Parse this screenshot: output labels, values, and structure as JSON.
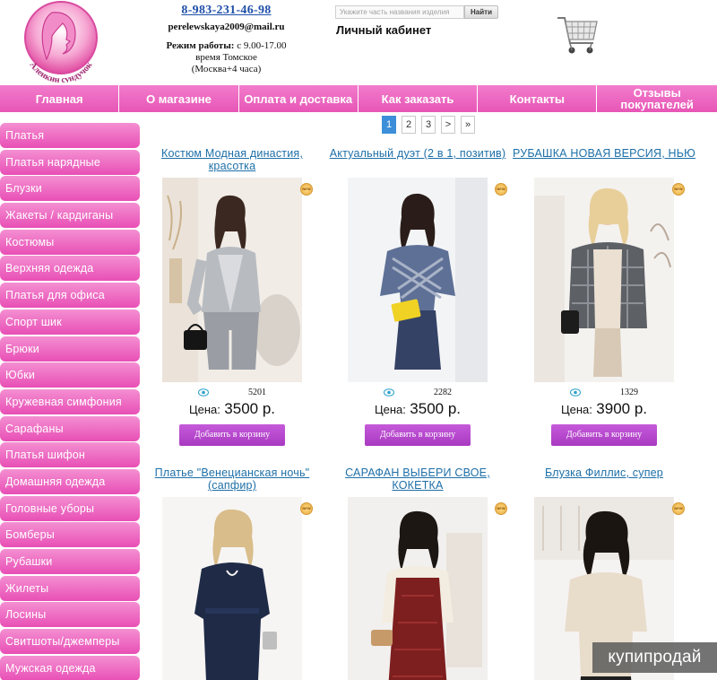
{
  "header": {
    "logo_text": "Аленкин сундучок",
    "phone": "8-983-231-46-98",
    "email": "perelewskaya2009@mail.ru",
    "hours_label": "Режим работы:",
    "hours_value": "с 9.00-17.00",
    "hours_zone": "время Томское",
    "hours_offset": "(Москва+4 часа)",
    "search_placeholder": "Укажите часть названия изделия",
    "search_button": "Найти",
    "account": "Личный кабинет"
  },
  "topnav": [
    "Главная",
    "О магазине",
    "Оплата и доставка",
    "Как заказать",
    "Контакты",
    "Отзывы покупателей"
  ],
  "sidebar": [
    "Платья",
    "Платья нарядные",
    "Блузки",
    "Жакеты / кардиганы",
    "Костюмы",
    "Верхняя одежда",
    "Платья для офиса",
    "Спорт шик",
    "Брюки",
    "Юбки",
    "Кружевная симфония",
    "Сарафаны",
    "Платья шифон",
    "Домашняя одежда",
    "Головные уборы",
    "Бомберы",
    "Рубашки",
    "Жилеты",
    "Лосины",
    "Свитшоты/джемперы",
    "Мужская одежда"
  ],
  "pagination": [
    "1",
    "2",
    "3",
    ">",
    "»"
  ],
  "price_label": "Цена:",
  "add_to_cart": "Добавить в корзину",
  "products": [
    {
      "title": "Костюм Модная династия, красотка",
      "views": "5201",
      "price": "3500 р.",
      "badge": "NEW"
    },
    {
      "title": "Актуальный дуэт (2 в 1, позитив)",
      "views": "2282",
      "price": "3500 р.",
      "badge": "NEW"
    },
    {
      "title": "РУБАШКА НОВАЯ ВЕРСИЯ, НЬЮ",
      "views": "1329",
      "price": "3900 р.",
      "badge": "NEW"
    },
    {
      "title": "Платье \"Венецианская ночь\" (сапфир)",
      "badge": "NEW"
    },
    {
      "title": "САРАФАН ВЫБЕРИ СВОЕ, КОКЕТКА",
      "badge": "NEW"
    },
    {
      "title": "Блузка Филлис, супер",
      "badge": "NEW"
    }
  ],
  "watermark": "купипродай",
  "colors": {
    "nav_pink": "#e756b6",
    "sidebar_pink": "#f48fd2",
    "link_blue": "#1e6fa8",
    "button_purple": "#a93ac2",
    "page_active": "#3c8fd8"
  }
}
